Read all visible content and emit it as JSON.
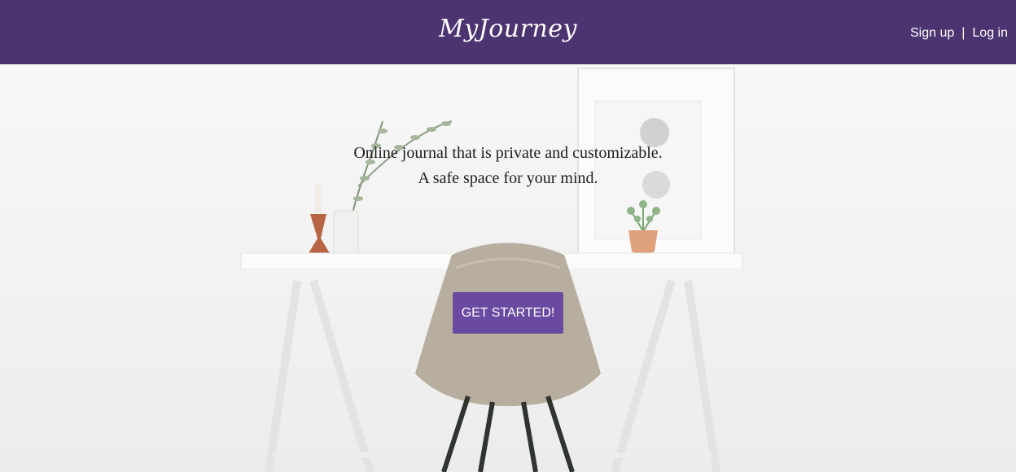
{
  "header": {
    "logo": "MyJourney",
    "signup_label": "Sign up",
    "separator": "|",
    "login_label": "Log in"
  },
  "hero": {
    "tagline_line1": "Online journal that is private and customizable.",
    "tagline_line2": "A safe space for your mind.",
    "cta_label": "GET STARTED!"
  },
  "colors": {
    "header_bg": "#4b3470",
    "button_bg": "#6a4aa0"
  }
}
